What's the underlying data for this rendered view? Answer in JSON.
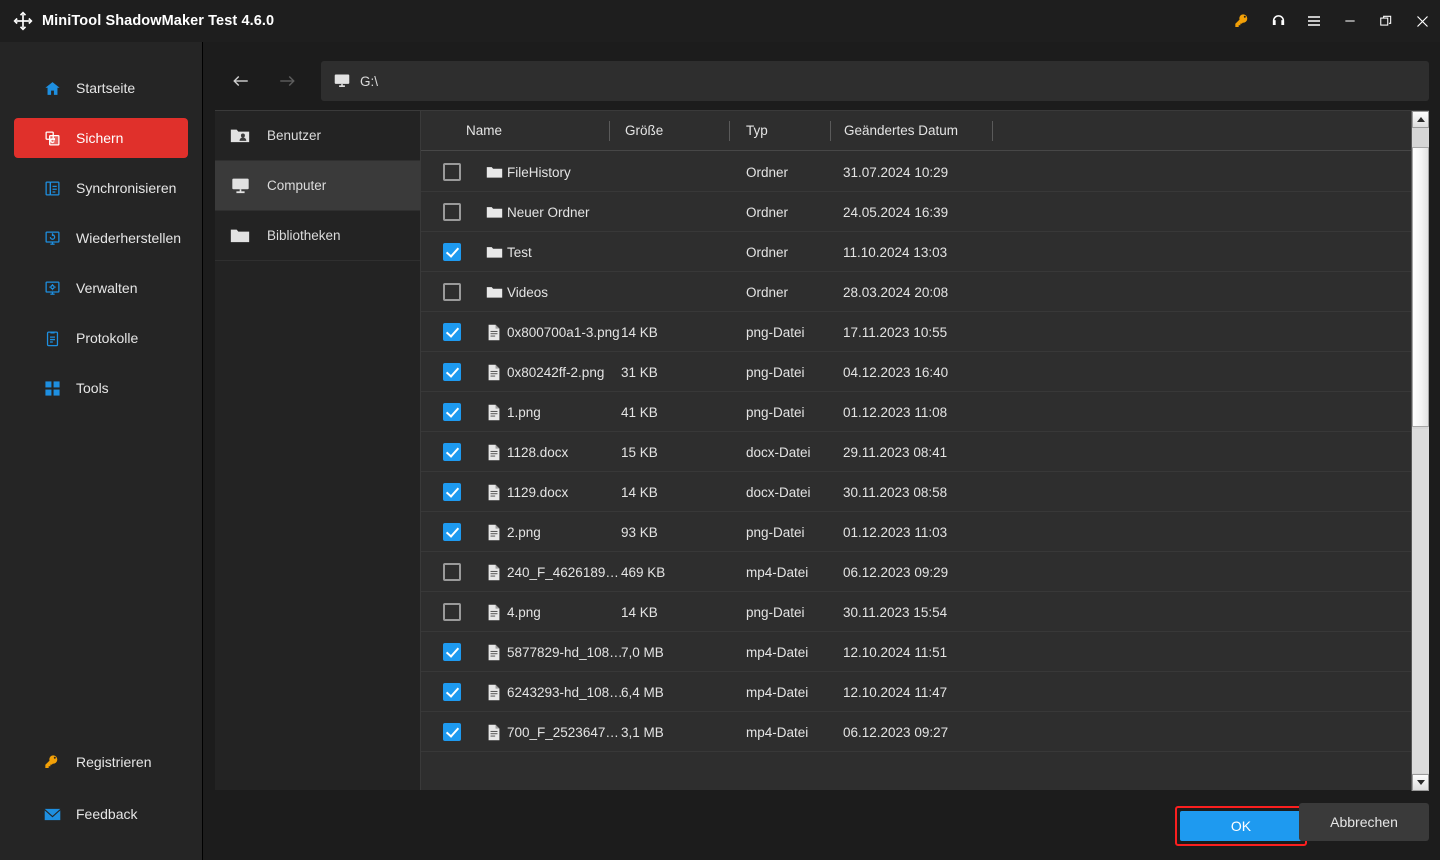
{
  "window": {
    "title": "MiniTool ShadowMaker Test 4.6.0",
    "logo_icon": "shadowmaker-logo-icon",
    "actions": [
      {
        "name": "license-key-button",
        "icon": "key-icon",
        "color": "#f2a007"
      },
      {
        "name": "support-button",
        "icon": "headset-icon",
        "color": "#ffffff"
      },
      {
        "name": "menu-button",
        "icon": "hamburger-menu-icon",
        "color": "#ffffff"
      },
      {
        "name": "minimize-button",
        "icon": "minimize-icon",
        "color": "#ffffff"
      },
      {
        "name": "restore-button",
        "icon": "restore-icon",
        "color": "#ffffff"
      },
      {
        "name": "close-button",
        "icon": "close-icon",
        "color": "#ffffff"
      }
    ]
  },
  "sidebar": {
    "accent_active": "#e0302b",
    "icon_color": "#1e8fe0",
    "items": [
      {
        "label": "Startseite",
        "icon": "home-icon",
        "active": false
      },
      {
        "label": "Sichern",
        "icon": "backup-icon",
        "active": true
      },
      {
        "label": "Synchronisieren",
        "icon": "sync-icon",
        "active": false
      },
      {
        "label": "Wiederherstellen",
        "icon": "restore-monitor-icon",
        "active": false
      },
      {
        "label": "Verwalten",
        "icon": "manage-gear-icon",
        "active": false
      },
      {
        "label": "Protokolle",
        "icon": "logs-clipboard-icon",
        "active": false
      },
      {
        "label": "Tools",
        "icon": "tools-grid-icon",
        "active": false
      }
    ],
    "bottom_items": [
      {
        "label": "Registrieren",
        "icon": "key-icon",
        "color": "#f2a007"
      },
      {
        "label": "Feedback",
        "icon": "mail-icon",
        "color": "#1e9af0"
      }
    ]
  },
  "pathbar": {
    "back_icon": "arrow-left-icon",
    "forward_icon": "arrow-right-icon",
    "location_icon": "computer-monitor-icon",
    "value": "G:\\"
  },
  "tree": {
    "items": [
      {
        "label": "Benutzer",
        "icon": "users-folder-icon",
        "selected": false
      },
      {
        "label": "Computer",
        "icon": "computer-monitor-icon",
        "selected": true
      },
      {
        "label": "Bibliotheken",
        "icon": "folder-icon",
        "selected": false
      }
    ]
  },
  "filelist": {
    "columns": [
      {
        "key": "name",
        "label": "Name"
      },
      {
        "key": "size",
        "label": "Größe"
      },
      {
        "key": "type",
        "label": "Typ"
      },
      {
        "key": "date",
        "label": "Geändertes Datum"
      }
    ],
    "rows": [
      {
        "checked": false,
        "icon": "folder-icon",
        "name": "FileHistory",
        "size": "",
        "type": "Ordner",
        "date": "31.07.2024 10:29"
      },
      {
        "checked": false,
        "icon": "folder-icon",
        "name": "Neuer Ordner",
        "size": "",
        "type": "Ordner",
        "date": "24.05.2024 16:39"
      },
      {
        "checked": true,
        "icon": "folder-icon",
        "name": "Test",
        "size": "",
        "type": "Ordner",
        "date": "11.10.2024 13:03"
      },
      {
        "checked": false,
        "icon": "folder-icon",
        "name": "Videos",
        "size": "",
        "type": "Ordner",
        "date": "28.03.2024 20:08"
      },
      {
        "checked": true,
        "icon": "document-icon",
        "name": "0x800700a1-3.png",
        "size": "14 KB",
        "type": "png-Datei",
        "date": "17.11.2023 10:55"
      },
      {
        "checked": true,
        "icon": "document-icon",
        "name": "0x80242ff-2.png",
        "size": "31 KB",
        "type": "png-Datei",
        "date": "04.12.2023 16:40"
      },
      {
        "checked": true,
        "icon": "document-icon",
        "name": "1.png",
        "size": "41 KB",
        "type": "png-Datei",
        "date": "01.12.2023 11:08"
      },
      {
        "checked": true,
        "icon": "document-icon",
        "name": "1128.docx",
        "size": "15 KB",
        "type": "docx-Datei",
        "date": "29.11.2023 08:41"
      },
      {
        "checked": true,
        "icon": "document-icon",
        "name": "1129.docx",
        "size": "14 KB",
        "type": "docx-Datei",
        "date": "30.11.2023 08:58"
      },
      {
        "checked": true,
        "icon": "document-icon",
        "name": "2.png",
        "size": "93 KB",
        "type": "png-Datei",
        "date": "01.12.2023 11:03"
      },
      {
        "checked": false,
        "icon": "document-icon",
        "name": "240_F_4626189…",
        "size": "469 KB",
        "type": "mp4-Datei",
        "date": "06.12.2023 09:29"
      },
      {
        "checked": false,
        "icon": "document-icon",
        "name": "4.png",
        "size": "14 KB",
        "type": "png-Datei",
        "date": "30.11.2023 15:54"
      },
      {
        "checked": true,
        "icon": "document-icon",
        "name": "5877829-hd_108…",
        "size": "7,0 MB",
        "type": "mp4-Datei",
        "date": "12.10.2024 11:51"
      },
      {
        "checked": true,
        "icon": "document-icon",
        "name": "6243293-hd_108…",
        "size": "6,4 MB",
        "type": "mp4-Datei",
        "date": "12.10.2024 11:47"
      },
      {
        "checked": true,
        "icon": "document-icon",
        "name": "700_F_2523647…",
        "size": "3,1 MB",
        "type": "mp4-Datei",
        "date": "06.12.2023 09:27"
      }
    ],
    "scrollbar": {
      "up_icon": "scroll-up-arrow-icon",
      "down_icon": "scroll-down-arrow-icon"
    }
  },
  "footer": {
    "ok_label": "OK",
    "cancel_label": "Abbrechen",
    "ok_accent": "#1e9af0",
    "ok_highlight_border": "#fb1f1f"
  }
}
